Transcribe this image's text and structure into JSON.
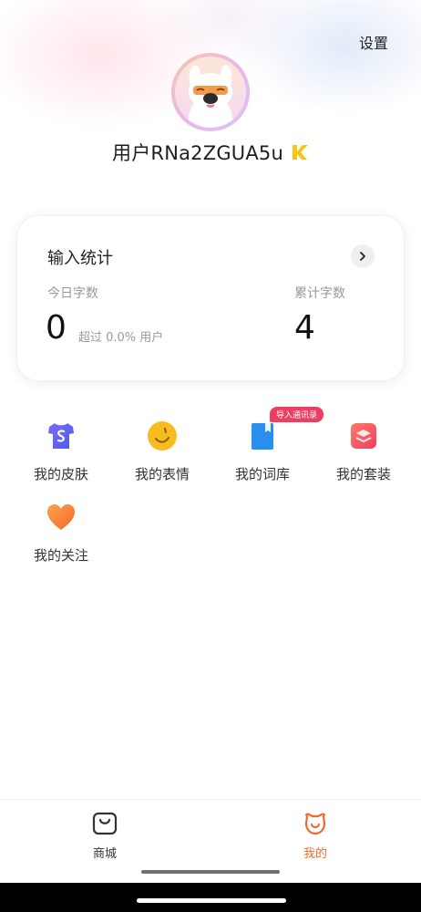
{
  "header": {
    "settings_label": "设置"
  },
  "profile": {
    "username": "用户RNa2ZGUA5u",
    "vip_badge_icon": "k-vip-badge-icon"
  },
  "stats_card": {
    "title": "输入统计",
    "today_label": "今日字数",
    "today_value": "0",
    "today_sub": "超过 0.0% 用户",
    "total_label": "累计字数",
    "total_value": "4"
  },
  "menu": {
    "items": [
      {
        "label": "我的皮肤",
        "icon": "tshirt-icon"
      },
      {
        "label": "我的表情",
        "icon": "emoji-icon"
      },
      {
        "label": "我的词库",
        "icon": "book-icon"
      },
      {
        "label": "我的套装",
        "icon": "layers-icon"
      },
      {
        "label": "我的关注",
        "icon": "heart-icon"
      }
    ],
    "badge": "导入通讯录"
  },
  "tabbar": {
    "tabs": [
      {
        "label": "商城",
        "icon": "shopping-bag-icon",
        "active": false
      },
      {
        "label": "我的",
        "icon": "me-face-icon",
        "active": true
      }
    ]
  },
  "colors": {
    "accent": "#f06a2c",
    "badge": "#ee3d63",
    "primary_text": "#222222",
    "muted_text": "#999999"
  }
}
